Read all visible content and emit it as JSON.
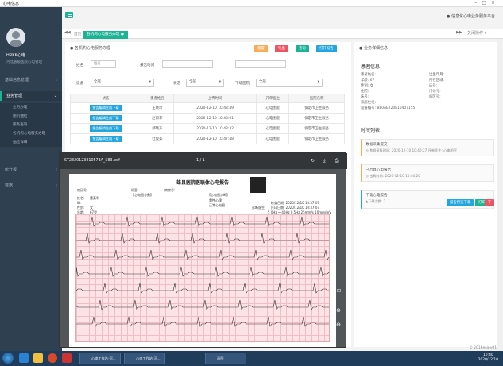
{
  "window": {
    "title": "心电信息"
  },
  "user": {
    "name": "HRKK心电",
    "role": "河北省级医院心电管理"
  },
  "sidebar": {
    "items": [
      {
        "label": "基础信息管理",
        "arrow": "‹"
      },
      {
        "label": "业务管理",
        "arrow": "⌄",
        "active": true
      },
      {
        "label": "统计报",
        "arrow": "‹"
      },
      {
        "label": "数据",
        "arrow": "‹"
      }
    ],
    "subitems": [
      "业务办理",
      "随机抽检",
      "服务查询",
      "各机构心电服务办理",
      "抽检详细"
    ]
  },
  "topbar": {
    "right_text": "● 信息化心电业务服务平台"
  },
  "tabs": [
    {
      "label": "首页"
    },
    {
      "label": "各机构心电服务办理 ●",
      "active": true
    }
  ],
  "tabnav": {
    "left": "◀◀",
    "right": "▶▶",
    "action": "关闭操作 ▾"
  },
  "left_panel": {
    "title": "● 各机构心电服务办理",
    "buttons": {
      "reset": "重置",
      "export": "导出",
      "search": "查询",
      "open": "打开报告"
    },
    "filters": {
      "name_label": "姓名",
      "name_placeholder": "姓名",
      "date_label": "报告时间",
      "date_sep": "-",
      "device_label": "设备",
      "device_value": "全部",
      "status_label": "状态",
      "status_value": "全部",
      "hosp_label": "下级医院",
      "hosp_value": "全部"
    },
    "table": {
      "headers": [
        "状态",
        "患者姓名",
        "上传时间",
        "开单医生",
        "医院名称"
      ],
      "rows": [
        {
          "status": "报告编辑生成下载",
          "name": "王晓玲",
          "time": "2020-12-10 10:48:49",
          "doctor": "心电图室",
          "hospital": "保定市卫生服务"
        },
        {
          "status": "报告编辑生成下载",
          "name": "赵雨菲",
          "time": "2020-12-10 10:48:01",
          "doctor": "心电图室",
          "hospital": "保定市卫生服务"
        },
        {
          "status": "报告编辑生成下载",
          "name": "郝晓东",
          "time": "2020-12-10 10:48:32",
          "doctor": "心电图室",
          "hospital": "保定市卫生服务"
        },
        {
          "status": "报告编辑生成下载",
          "name": "杜俊茹",
          "time": "2020-12-10 10:47:48",
          "doctor": "心电图室",
          "hospital": "保定市卫生服务"
        }
      ]
    }
  },
  "right_panel": {
    "title": "● 业务详细信息",
    "section1": "患者信息",
    "fields": [
      {
        "k": "患者姓名:",
        "v": ""
      },
      {
        "k": "出生年月:",
        "v": ""
      },
      {
        "k": "年龄:",
        "v": "67"
      },
      {
        "k": "所在区域:",
        "v": ""
      },
      {
        "k": "性别:",
        "v": "女"
      },
      {
        "k": "床号:",
        "v": ""
      },
      {
        "k": "住院:",
        "v": ""
      },
      {
        "k": "门诊号:",
        "v": ""
      },
      {
        "k": "床号:",
        "v": ""
      },
      {
        "k": "病区号:",
        "v": ""
      },
      {
        "k": "家庭住址:",
        "v": ""
      },
      {
        "k": "设备编号:",
        "v": "BE0AE220810407155"
      }
    ],
    "section2": "时间列表",
    "cards": [
      {
        "t": "数据采集提交",
        "s": "◎ 数据采集时间: 2020-12-10 10:40:27  开单医生: 心电图室"
      },
      {
        "t": "已出具心电报告",
        "s": "◎ 出具时间: 2020-12-10 10:40:20"
      },
      {
        "t": "下载心电报告",
        "s": "▲下载次数: 2"
      }
    ],
    "card_buttons": {
      "preview": "报告预览下载",
      "print": "打印",
      "delete": "下载"
    }
  },
  "pdf": {
    "filename": "ST2820123810573A_583.pdf",
    "page": "1 / 1",
    "report_title": "雄县医院医联体心电报告",
    "header_left": "病历号:",
    "header_mid": "科室:",
    "header_right": "病房号:",
    "patient": [
      "姓名:",
      "董某利",
      "ID:",
      "性别:",
      "女",
      "年龄:",
      "67岁"
    ],
    "measure_title": "【心电图参数】",
    "diag_title": "【心电图诊断】",
    "diag_lines": [
      "窦性心律",
      "正常心电图"
    ],
    "check_date": "检查日期: 2020/12/10 10:37:07",
    "report_date": "打印日期: 2020/12/10 10:37:07",
    "doctor": "诊断医生:",
    "speed": "5 0Hz ~ 40Hz 0.5Hz 25mm/s 10mm/mV"
  },
  "taskbar": {
    "tasks": [
      {
        "label": "心电工作站-河..."
      },
      {
        "label": "心电工作站-河..."
      },
      {
        "label": "画图"
      }
    ],
    "time": "10:40",
    "date": "2020/12/10"
  },
  "footer": {
    "copyright": "© 2016ecg-v01"
  }
}
